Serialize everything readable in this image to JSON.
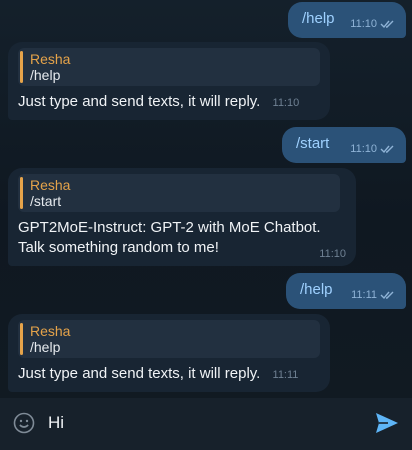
{
  "messages": [
    {
      "type": "out",
      "text": "/help",
      "time": "11:10"
    },
    {
      "type": "in",
      "reply_name": "Resha",
      "reply_text": "/help",
      "text": "Just type and send texts, it will reply.",
      "time": "11:10"
    },
    {
      "type": "out",
      "text": "/start",
      "time": "11:10"
    },
    {
      "type": "in",
      "reply_name": "Resha",
      "reply_text": "/start",
      "text_line1": "GPT2MoE-Instruct: GPT-2 with MoE Chatbot.",
      "text_line2": "Talk something random to me!",
      "time": "11:10"
    },
    {
      "type": "out",
      "text": "/help",
      "time": "11:11"
    },
    {
      "type": "in",
      "reply_name": "Resha",
      "reply_text": "/help",
      "text": "Just type and send texts, it will reply.",
      "time": "11:11"
    }
  ],
  "composer": {
    "value": "Hi",
    "emoji_icon": "smiley-icon",
    "send_icon": "send-arrow-icon"
  },
  "colors": {
    "outgoing_bubble": "#2b5278",
    "incoming_bubble": "#182533",
    "reply_accent": "#e5a34a",
    "send_accent": "#5eb5f7"
  }
}
